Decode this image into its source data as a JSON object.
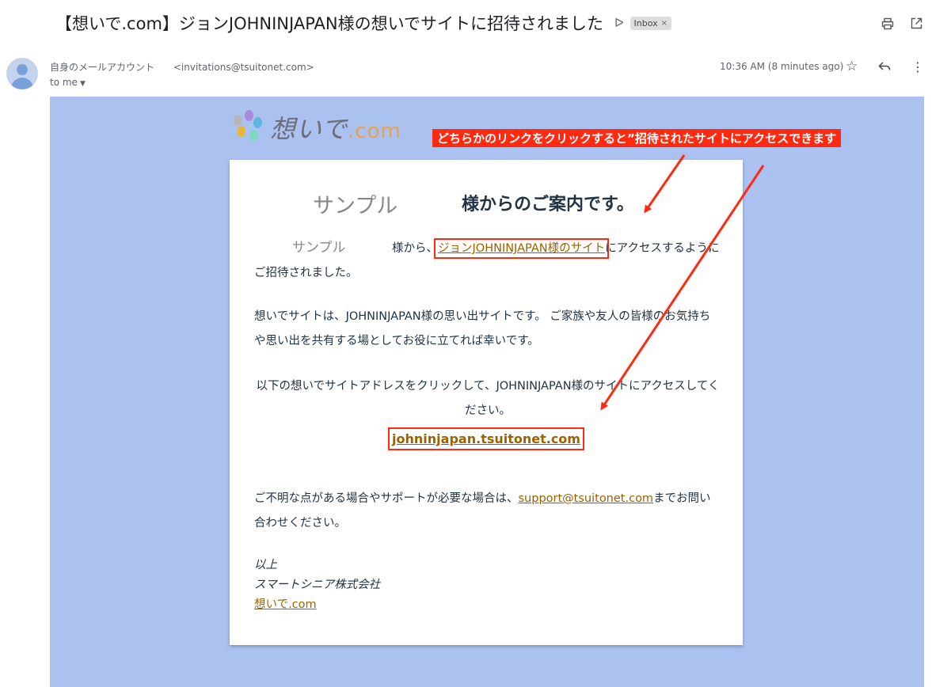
{
  "email": {
    "subject": "【想いで.com】ジョンJOHNINJAPAN様の想いでサイトに招待されました",
    "label": "Inbox",
    "label_close": "×",
    "sender_name": "自身のメールアカウント",
    "sender_email": "<invitations@tsuitonet.com>",
    "to": "to me",
    "time": "10:36 AM (8 minutes ago)"
  },
  "icons": {
    "important": "important-marker-icon",
    "print": "print-icon",
    "open_new": "open-in-new-window-icon",
    "star": "star-icon",
    "reply": "reply-icon",
    "more": "more-vert-icon"
  },
  "body": {
    "logo_text": "想いで",
    "logo_suffix": ".com",
    "annotation": "どちらかのリンクをクリックすると”招待されたサイトにアクセスできます",
    "sample_name": "サンプル",
    "heading": "様からのご案内です。",
    "p1_prefix": "様から、",
    "p1_link": "ジョンJOHNINJAPAN様のサイト",
    "p1_suffix": "にアクセスするようにご招待されました。",
    "p2": "想いでサイトは、JOHNINJAPAN様の思い出サイトです。 ご家族や友人の皆様のお気持ちや思い出を共有する場としてお役に立てれば幸いです。",
    "p3": "以下の想いでサイトアドレスをクリックして、JOHNINJAPAN様のサイトにアクセスしてください。",
    "site_link": "johninjapan.tsuitonet.com",
    "p4_prefix": "ご不明な点がある場合やサポートが必要な場合は、",
    "p4_link": "support@tsuitonet.com",
    "p4_suffix": "までお問い合わせください。",
    "sign_1": "以上",
    "sign_2": "スマートシニア株式会社",
    "sign_link": "想いで.com"
  },
  "colors": {
    "banner": "#abc1f0",
    "link": "#9b6200",
    "annotation": "#ff2a10"
  }
}
